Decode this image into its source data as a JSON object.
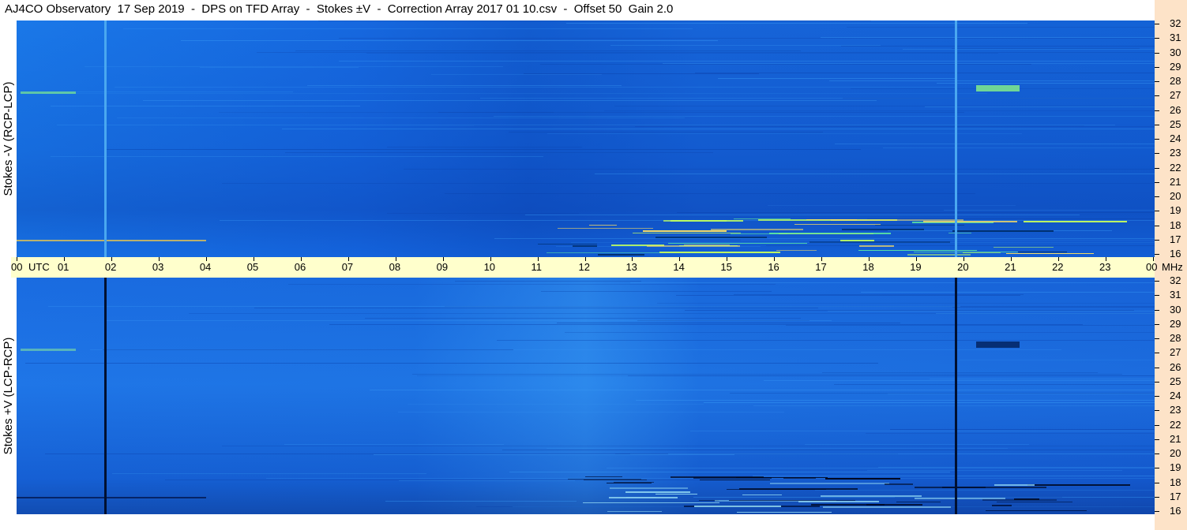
{
  "header": {
    "title": "AJ4CO Observatory  17 Sep 2019  -  DPS on TFD Array  -  Stokes ±V  -  Correction Array 2017 01 10.csv  -  Offset 50  Gain 2.0"
  },
  "chart_data": [
    {
      "type": "heatmap",
      "ylabel": "Stokes -V (RCP-LCP)",
      "x_unit": "UTC",
      "y_unit": "MHz",
      "x_ticks": [
        "00",
        "01",
        "02",
        "03",
        "04",
        "05",
        "06",
        "07",
        "08",
        "09",
        "10",
        "11",
        "12",
        "13",
        "14",
        "15",
        "16",
        "17",
        "18",
        "19",
        "20",
        "21",
        "22",
        "23",
        "00"
      ],
      "y_ticks": [
        32,
        31,
        30,
        29,
        28,
        27,
        26,
        25,
        24,
        23,
        22,
        21,
        20,
        19,
        18,
        17,
        16
      ],
      "xlim": [
        0,
        24
      ],
      "ylim": [
        16,
        32
      ]
    },
    {
      "type": "heatmap",
      "ylabel": "Stokes +V (LCP-RCP)",
      "x_unit": "UTC",
      "y_unit": "MHz",
      "x_ticks": [
        "00",
        "01",
        "02",
        "03",
        "04",
        "05",
        "06",
        "07",
        "08",
        "09",
        "10",
        "11",
        "12",
        "13",
        "14",
        "15",
        "16",
        "17",
        "18",
        "19",
        "20",
        "21",
        "22",
        "23",
        "00"
      ],
      "y_ticks": [
        32,
        31,
        30,
        29,
        28,
        27,
        26,
        25,
        24,
        23,
        22,
        21,
        20,
        19,
        18,
        17,
        16
      ],
      "xlim": [
        0,
        24
      ],
      "ylim": [
        16,
        32
      ]
    }
  ],
  "colors": {
    "background_blue": "#1664d8",
    "axis_strip": "#ffffcc",
    "side_strip": "#fde3c8"
  }
}
